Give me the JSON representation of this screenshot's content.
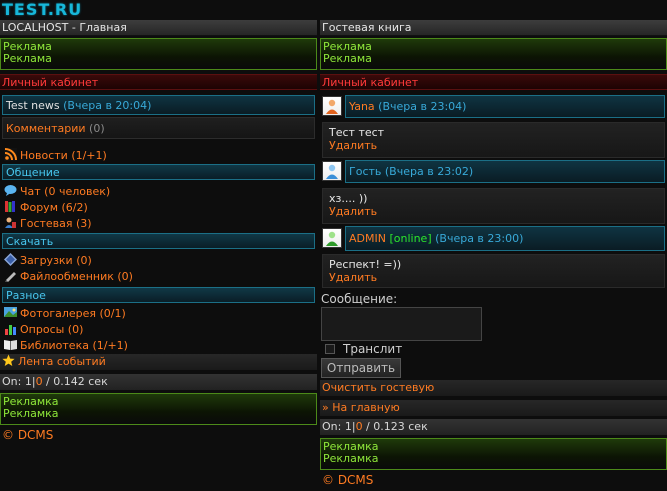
{
  "site": {
    "logo": "TEST.RU"
  },
  "left": {
    "title": "LOCALHOST - Главная",
    "ad_top": [
      "Реклама",
      "Реклама"
    ],
    "cabinet": "Личный кабинет",
    "news_link": "Test news",
    "news_time": "(Вчера в 20:04)",
    "comments_label": "Комментарии",
    "comments_count": "(0)",
    "news_item": "Новости (1/+1)",
    "section_communication": "Общение",
    "chat": "Чат (0 человек)",
    "forum": "Форум (6/2)",
    "guestbook": "Гостевая (3)",
    "section_download": "Скачать",
    "downloads": "Загрузки (0)",
    "fileshare": "Файлообменник (0)",
    "section_misc": "Разное",
    "photos": "Фотогалерея (0/1)",
    "polls": "Опросы (0)",
    "library": "Библиотека (1/+1)",
    "events": "Лента событий",
    "online_prefix": "On: 1",
    "online_sep": "|",
    "online_count": "0",
    "online_suffix": " / 0.142 сек",
    "ad_bottom": [
      "Рекламка",
      "Рекламка"
    ],
    "copyright": "© DCMS"
  },
  "right": {
    "title": "Гостевая книга",
    "ad_top": [
      "Реклама",
      "Реклама"
    ],
    "cabinet": "Личный кабинет",
    "messages": [
      {
        "author": "Yana",
        "online": "",
        "time": "(Вчера в 23:04)",
        "text": "Тест тест",
        "delete": "Удалить"
      },
      {
        "author": "Гость",
        "online": "",
        "time": "(Вчера в 23:02)",
        "text": "хз.... ))",
        "delete": "Удалить"
      },
      {
        "author": "ADMIN",
        "online": "[online]",
        "time": "(Вчера в 23:00)",
        "text": "Респект! =))",
        "delete": "Удалить"
      }
    ],
    "message_label": "Сообщение:",
    "translit": "Транслит",
    "send": "Отправить",
    "clear": "Очистить гостевую",
    "home": "» На главную",
    "online_prefix": "On: 1",
    "online_sep": "|",
    "online_count": "0",
    "online_suffix": " / 0.123 сек",
    "ad_bottom": [
      "Рекламка",
      "Рекламка"
    ],
    "copyright": "© DCMS"
  },
  "colors": {
    "accent_orange": "#ff7b22",
    "accent_cyan": "#38a9d8",
    "ad_green": "#8fe83a",
    "red": "#ff3a3a"
  }
}
